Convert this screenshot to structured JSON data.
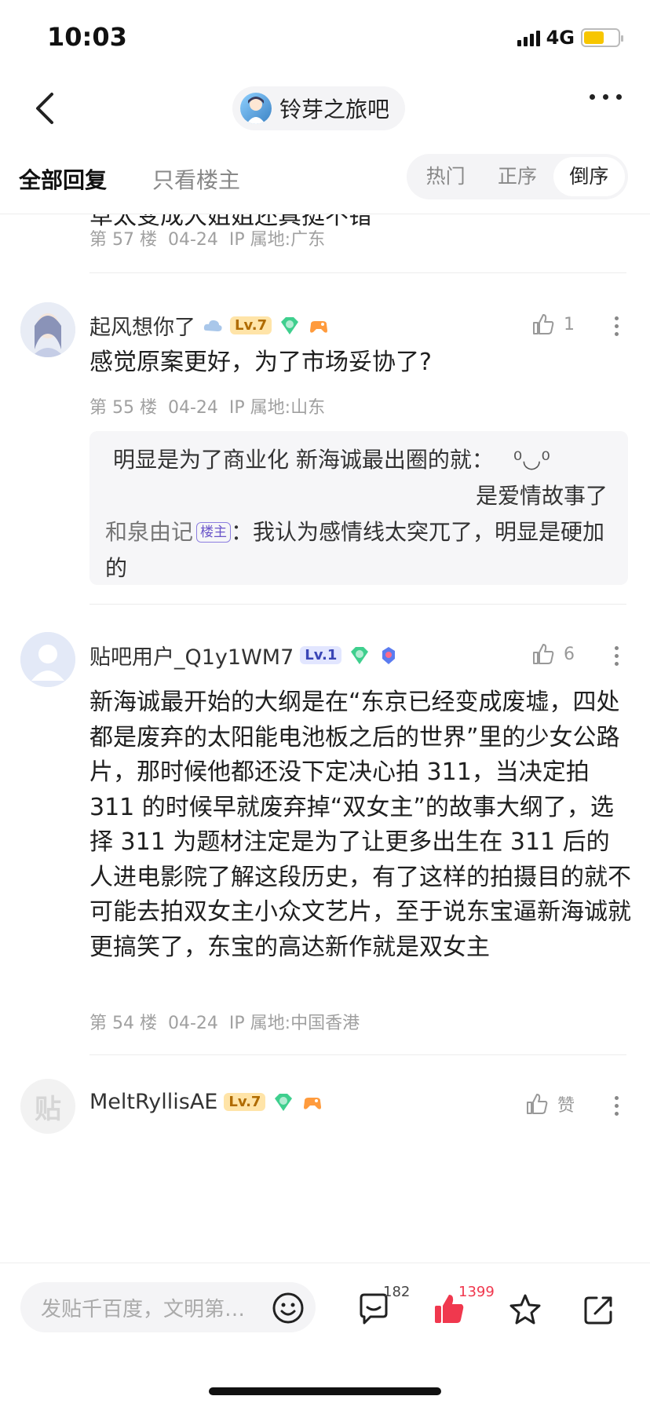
{
  "status": {
    "time": "10:03",
    "network": "4G"
  },
  "nav": {
    "forum_name": "铃芽之旅吧"
  },
  "tabs": {
    "all_replies": "全部回复",
    "owner_only": "只看楼主",
    "sort": [
      "热门",
      "正序",
      "倒序"
    ],
    "sort_active": "倒序"
  },
  "posts": [
    {
      "partial_text": "草太变成大姐姐还真挺不错",
      "floor": "第 57 楼",
      "date": "04-24",
      "ip": "IP 属地:广东"
    },
    {
      "username": "起风想你了",
      "level": "Lv.7",
      "likes": "1",
      "text": "感觉原案更好，为了市场妥协了?",
      "floor": "第 55 楼",
      "date": "04-24",
      "ip": "IP 属地:山东",
      "replies": [
        {
          "author": "",
          "text": "明显是为了商业化 新海诚最出圈的就：",
          "emoticon": "⁰◡⁰",
          "text2": "是爱情故事了"
        },
        {
          "author": "和泉由记",
          "tag": "楼主",
          "text": "：我认为感情线太突兀了，明显是硬加的"
        }
      ]
    },
    {
      "username": "贴吧用户_Q1y1WM7",
      "level": "Lv.1",
      "likes": "6",
      "text": "新海诚最开始的大纲是在“东京已经变成废墟，四处都是废弃的太阳能电池板之后的世界”里的少女公路片，那时候他都还没下定决心拍 311，当决定拍 311 的时候早就废弃掉“双女主”的故事大纲了，选择 311 为题材注定是为了让更多出生在 311 后的人进电影院了解这段历史，有了这样的拍摄目的就不可能去拍双女主小众文艺片，至于说东宝逼新海诚就更搞笑了，东宝的高达新作就是双女主",
      "floor": "第 54 楼",
      "date": "04-24",
      "ip": "IP 属地:中国香港"
    },
    {
      "username": "MeltRyllisAE",
      "level": "Lv.7",
      "likes": "赞",
      "avatar_text": "贴"
    }
  ],
  "bottom": {
    "input_placeholder": "发贴千百度，文明第…",
    "comments": "182",
    "likes": "1399"
  },
  "colors": {
    "accent_red": "#f0384e",
    "level_gold": "#b06b00",
    "level_blue": "#3a46b6"
  }
}
